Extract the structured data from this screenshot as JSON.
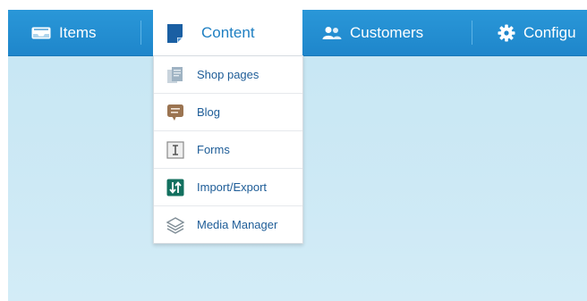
{
  "nav": {
    "items_label": "Items",
    "content_label": "Content",
    "customers_label": "Customers",
    "config_label": "Configu"
  },
  "dropdown": {
    "items": [
      {
        "label": "Shop pages",
        "icon": "pages-icon"
      },
      {
        "label": "Blog",
        "icon": "speech-bubble-icon"
      },
      {
        "label": "Forms",
        "icon": "text-cursor-icon"
      },
      {
        "label": "Import/Export",
        "icon": "import-export-icon"
      },
      {
        "label": "Media Manager",
        "icon": "layers-icon"
      }
    ]
  },
  "colors": {
    "navbar": "#1e86cb",
    "active_text": "#1e7fc2",
    "menu_text": "#1d5c97"
  }
}
